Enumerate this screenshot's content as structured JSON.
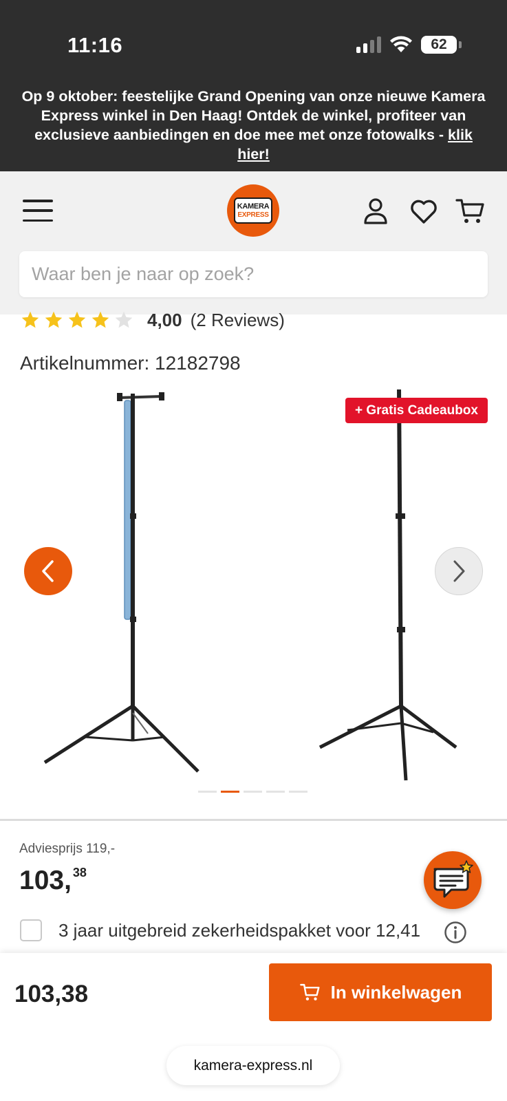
{
  "status_bar": {
    "time": "11:16",
    "battery_percent": "62",
    "battery_level": 0.62,
    "icons": [
      "signal-icon",
      "wifi-icon",
      "battery-icon"
    ]
  },
  "promo_banner": {
    "text_before_link": "Op 9 oktober: feestelijke Grand Opening van onze nieuwe Kamera Express winkel in Den Haag! Ontdek de winkel, profiteer van exclusieve aanbiedingen en doe mee met onze fotowalks - ",
    "link_text": "klik hier!"
  },
  "header": {
    "logo_line1": "KAMERA",
    "logo_line2": "EXPRESS",
    "icons": [
      "menu-icon",
      "account-icon",
      "heart-icon",
      "cart-icon"
    ],
    "search_placeholder": "Waar ben je naar op zoek?"
  },
  "product": {
    "rating_stars": 4,
    "rating_max": 5,
    "rating_score": "4,00",
    "rating_reviews": "(2 Reviews)",
    "article_number": "Artikelnummer: 12182798",
    "badge": "+ Gratis Cadeaubox",
    "gallery_slides": 5,
    "gallery_active_index": 1,
    "advice_price": "Adviesprijs 119,-",
    "price_main": "103,",
    "price_cents": "38",
    "warranty_text": "3 jaar uitgebreid zekerheidspakket voor 12,41",
    "warranty_checked": false
  },
  "sticky_bar": {
    "price": "103,38",
    "cart_button": "In winkelwagen"
  },
  "browser": {
    "url": "kamera-express.nl"
  },
  "colors": {
    "brand_orange": "#e8590c",
    "badge_red": "#e2132a",
    "star_yellow": "#f6c21b",
    "dark_bg": "#2e2e2e"
  }
}
